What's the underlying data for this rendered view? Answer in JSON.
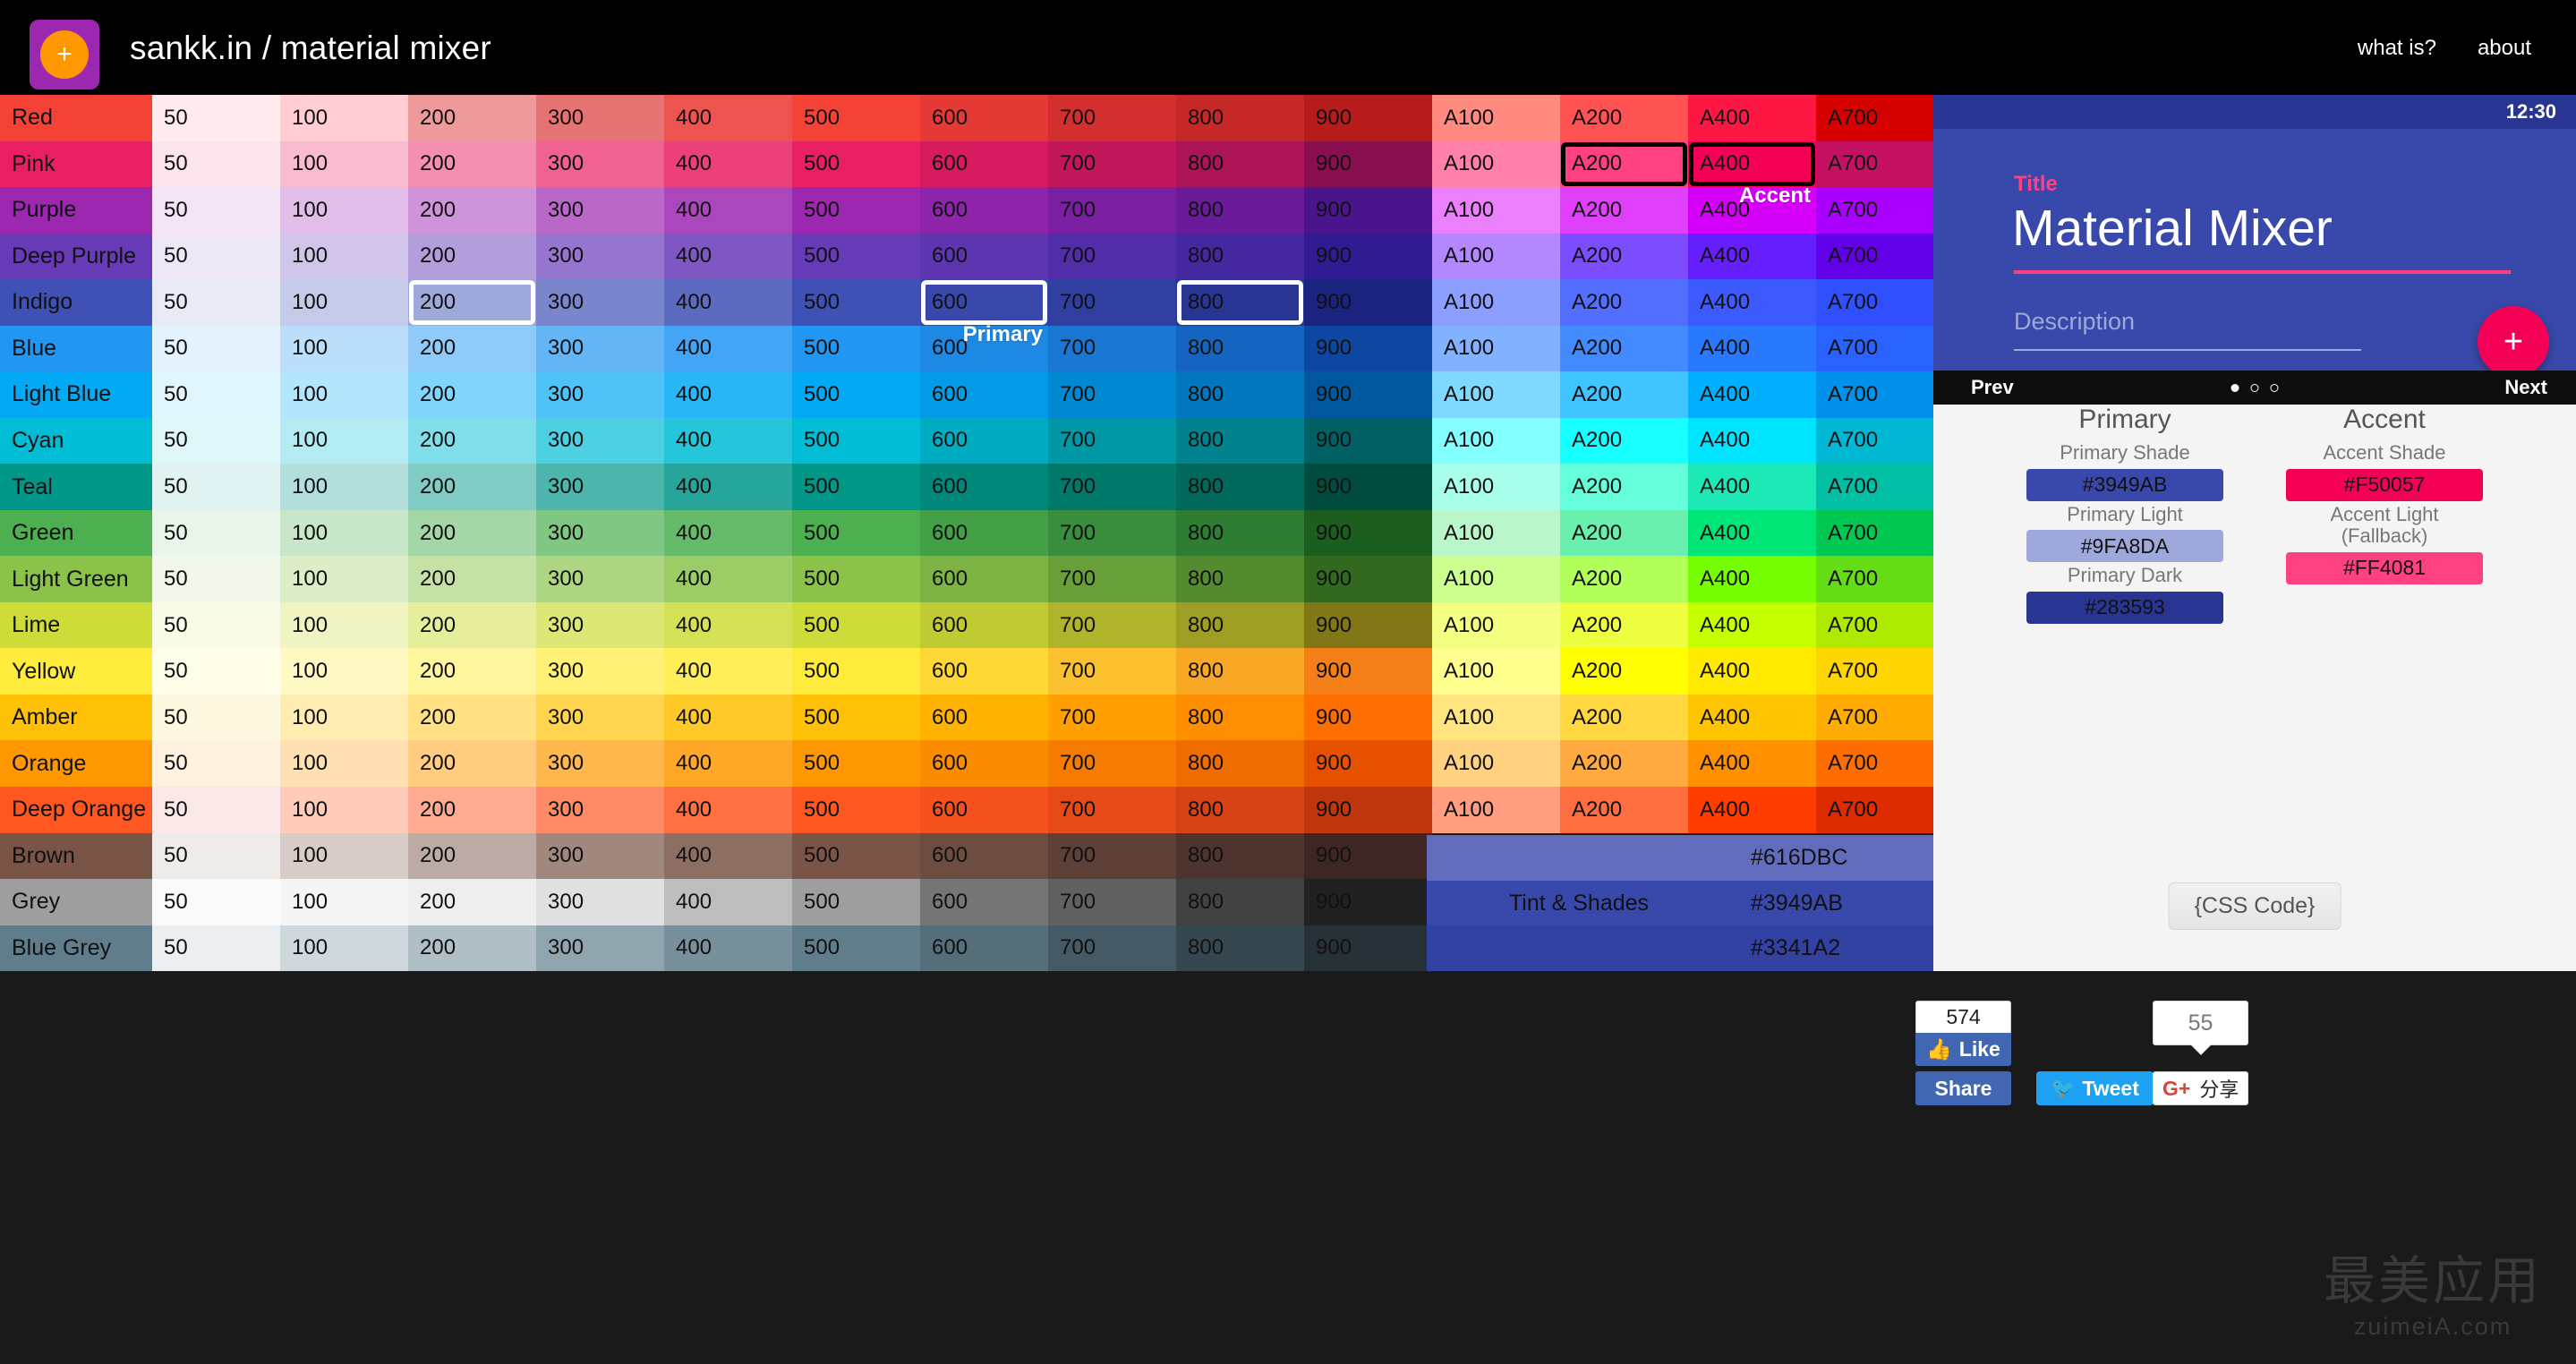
{
  "header": {
    "brand": "sankk.in / material mixer",
    "logo_plus": "+",
    "logo_bg": "#9C27B0",
    "logo_circle_bg": "#FF9800",
    "nav": [
      {
        "label": "what is?"
      },
      {
        "label": "about"
      }
    ]
  },
  "palette": {
    "shade_columns": [
      "50",
      "100",
      "200",
      "300",
      "400",
      "500",
      "600",
      "700",
      "800",
      "900"
    ],
    "accent_columns": [
      "A100",
      "A200",
      "A400",
      "A700"
    ],
    "rows": [
      {
        "name": "Red",
        "label_bg": "#F44336",
        "shades": [
          "#FFEBEE",
          "#FFCDD2",
          "#EF9A9A",
          "#E57373",
          "#EF5350",
          "#F44336",
          "#E53935",
          "#D32F2F",
          "#C62828",
          "#B71C1C"
        ],
        "accents": [
          "#FF8A80",
          "#FF5252",
          "#FF1744",
          "#D50000"
        ]
      },
      {
        "name": "Pink",
        "label_bg": "#E91E63",
        "shades": [
          "#FCE4EC",
          "#F8BBD0",
          "#F48FB1",
          "#F06292",
          "#EC407A",
          "#E91E63",
          "#D81B60",
          "#C2185B",
          "#AD1457",
          "#880E4F"
        ],
        "accents": [
          "#FF80AB",
          "#FF4081",
          "#F50057",
          "#C51162"
        ]
      },
      {
        "name": "Purple",
        "label_bg": "#9C27B0",
        "shades": [
          "#F3E5F5",
          "#E1BEE7",
          "#CE93D8",
          "#BA68C8",
          "#AB47BC",
          "#9C27B0",
          "#8E24AA",
          "#7B1FA2",
          "#6A1B9A",
          "#4A148C"
        ],
        "accents": [
          "#EA80FC",
          "#E040FB",
          "#D500F9",
          "#AA00FF"
        ]
      },
      {
        "name": "Deep Purple",
        "label_bg": "#673AB7",
        "shades": [
          "#EDE7F6",
          "#D1C4E9",
          "#B39DDB",
          "#9575CD",
          "#7E57C2",
          "#673AB7",
          "#5E35B1",
          "#512DA8",
          "#4527A0",
          "#311B92"
        ],
        "accents": [
          "#B388FF",
          "#7C4DFF",
          "#651FFF",
          "#6200EA"
        ]
      },
      {
        "name": "Indigo",
        "label_bg": "#3F51B5",
        "shades": [
          "#E8EAF6",
          "#C5CAE9",
          "#9FA8DA",
          "#7986CB",
          "#5C6BC0",
          "#3F51B5",
          "#3949AB",
          "#303F9F",
          "#283593",
          "#1A237E"
        ],
        "accents": [
          "#8C9EFF",
          "#536DFE",
          "#3D5AFE",
          "#304FFE"
        ]
      },
      {
        "name": "Blue",
        "label_bg": "#2196F3",
        "shades": [
          "#E3F2FD",
          "#BBDEFB",
          "#90CAF9",
          "#64B5F6",
          "#42A5F5",
          "#2196F3",
          "#1E88E5",
          "#1976D2",
          "#1565C0",
          "#0D47A1"
        ],
        "accents": [
          "#82B1FF",
          "#448AFF",
          "#2979FF",
          "#2962FF"
        ]
      },
      {
        "name": "Light Blue",
        "label_bg": "#03A9F4",
        "shades": [
          "#E1F5FE",
          "#B3E5FC",
          "#81D4FA",
          "#4FC3F7",
          "#29B6F6",
          "#03A9F4",
          "#039BE5",
          "#0288D1",
          "#0277BD",
          "#01579B"
        ],
        "accents": [
          "#80D8FF",
          "#40C4FF",
          "#00B0FF",
          "#0091EA"
        ]
      },
      {
        "name": "Cyan",
        "label_bg": "#00BCD4",
        "shades": [
          "#E0F7FA",
          "#B2EBF2",
          "#80DEEA",
          "#4DD0E1",
          "#26C6DA",
          "#00BCD4",
          "#00ACC1",
          "#0097A7",
          "#00838F",
          "#006064"
        ],
        "accents": [
          "#84FFFF",
          "#18FFFF",
          "#00E5FF",
          "#00B8D4"
        ]
      },
      {
        "name": "Teal",
        "label_bg": "#009688",
        "shades": [
          "#E0F2F1",
          "#B2DFDB",
          "#80CBC4",
          "#4DB6AC",
          "#26A69A",
          "#009688",
          "#00897B",
          "#00796B",
          "#00695C",
          "#004D40"
        ],
        "accents": [
          "#A7FFEB",
          "#64FFDA",
          "#1DE9B6",
          "#00BFA5"
        ]
      },
      {
        "name": "Green",
        "label_bg": "#4CAF50",
        "shades": [
          "#E8F5E9",
          "#C8E6C9",
          "#A5D6A7",
          "#81C784",
          "#66BB6A",
          "#4CAF50",
          "#43A047",
          "#388E3C",
          "#2E7D32",
          "#1B5E20"
        ],
        "accents": [
          "#B9F6CA",
          "#69F0AE",
          "#00E676",
          "#00C853"
        ]
      },
      {
        "name": "Light Green",
        "label_bg": "#8BC34A",
        "shades": [
          "#F1F8E9",
          "#DCEDC8",
          "#C5E1A5",
          "#AED581",
          "#9CCC65",
          "#8BC34A",
          "#7CB342",
          "#689F38",
          "#558B2F",
          "#33691E"
        ],
        "accents": [
          "#CCFF90",
          "#B2FF59",
          "#76FF03",
          "#64DD17"
        ]
      },
      {
        "name": "Lime",
        "label_bg": "#CDDC39",
        "shades": [
          "#F9FBE7",
          "#F0F4C3",
          "#E6EE9C",
          "#DCE775",
          "#D4E157",
          "#CDDC39",
          "#C0CA33",
          "#AFB42B",
          "#9E9D24",
          "#827717"
        ],
        "accents": [
          "#F4FF81",
          "#EEFF41",
          "#C6FF00",
          "#AEEA00"
        ]
      },
      {
        "name": "Yellow",
        "label_bg": "#FFEB3B",
        "shades": [
          "#FFFDE7",
          "#FFF9C4",
          "#FFF59D",
          "#FFF176",
          "#FFEE58",
          "#FFEB3B",
          "#FDD835",
          "#FBC02D",
          "#F9A825",
          "#F57F17"
        ],
        "accents": [
          "#FFFF8D",
          "#FFFF00",
          "#FFEA00",
          "#FFD600"
        ]
      },
      {
        "name": "Amber",
        "label_bg": "#FFC107",
        "shades": [
          "#FFF8E1",
          "#FFECB3",
          "#FFE082",
          "#FFD54F",
          "#FFCA28",
          "#FFC107",
          "#FFB300",
          "#FFA000",
          "#FF8F00",
          "#FF6F00"
        ],
        "accents": [
          "#FFE57F",
          "#FFD740",
          "#FFC400",
          "#FFAB00"
        ]
      },
      {
        "name": "Orange",
        "label_bg": "#FF9800",
        "shades": [
          "#FFF3E0",
          "#FFE0B2",
          "#FFCC80",
          "#FFB74D",
          "#FFA726",
          "#FF9800",
          "#FB8C00",
          "#F57C00",
          "#EF6C00",
          "#E65100"
        ],
        "accents": [
          "#FFD180",
          "#FFAB40",
          "#FF9100",
          "#FF6D00"
        ]
      },
      {
        "name": "Deep Orange",
        "label_bg": "#FF5722",
        "shades": [
          "#FBE9E7",
          "#FFCCBC",
          "#FFAB91",
          "#FF8A65",
          "#FF7043",
          "#FF5722",
          "#F4511E",
          "#E64A19",
          "#D84315",
          "#BF360C"
        ],
        "accents": [
          "#FF9E80",
          "#FF6E40",
          "#FF3D00",
          "#DD2C00"
        ]
      },
      {
        "name": "Brown",
        "label_bg": "#795548",
        "shades": [
          "#EFEBE9",
          "#D7CCC8",
          "#BCAAA4",
          "#A1887F",
          "#8D6E63",
          "#795548",
          "#6D4C41",
          "#5D4037",
          "#4E342E",
          "#3E2723"
        ],
        "accents": []
      },
      {
        "name": "Grey",
        "label_bg": "#9E9E9E",
        "shades": [
          "#FAFAFA",
          "#F5F5F5",
          "#EEEEEE",
          "#E0E0E0",
          "#BDBDBD",
          "#9E9E9E",
          "#757575",
          "#616161",
          "#424242",
          "#212121"
        ],
        "accents": []
      },
      {
        "name": "Blue Grey",
        "label_bg": "#607D8B",
        "shades": [
          "#ECEFF1",
          "#CFD8DC",
          "#B0BEC5",
          "#90A4AE",
          "#78909C",
          "#607D8B",
          "#546E7A",
          "#455A64",
          "#37474F",
          "#263238"
        ],
        "accents": []
      }
    ],
    "selections": [
      {
        "row": "Indigo",
        "column": "200",
        "style": "white",
        "tag": ""
      },
      {
        "row": "Indigo",
        "column": "600",
        "style": "white",
        "tag": "Primary"
      },
      {
        "row": "Indigo",
        "column": "800",
        "style": "white",
        "tag": ""
      },
      {
        "row": "Pink",
        "column": "A200",
        "style": "black",
        "tag": ""
      },
      {
        "row": "Pink",
        "column": "A400",
        "style": "black",
        "tag": "Accent"
      }
    ]
  },
  "tints": {
    "label": "Tint & Shades",
    "rows": [
      {
        "hex": "#616DBC"
      },
      {
        "hex": "#3949AB"
      },
      {
        "hex": "#3341A2"
      }
    ]
  },
  "preview": {
    "status_time": "12:30",
    "status_bg": "#283593",
    "body_bg": "#3949AB",
    "title_label": "Title",
    "title": "Material Mixer",
    "title_accent": "#FF4081",
    "description_placeholder": "Description",
    "fab_label": "+",
    "fab_bg": "#F50057",
    "nav": {
      "prev": "Prev",
      "next": "Next",
      "dots": 3,
      "active_dot": 1
    }
  },
  "details": {
    "primary": {
      "heading": "Primary",
      "items": [
        {
          "label": "Primary Shade",
          "hex": "#3949AB"
        },
        {
          "label": "Primary Light",
          "hex": "#9FA8DA"
        },
        {
          "label": "Primary Dark",
          "hex": "#283593"
        }
      ]
    },
    "accent": {
      "heading": "Accent",
      "items": [
        {
          "label": "Accent Shade",
          "hex": "#F50057"
        },
        {
          "label": "Accent Light\n(Fallback)",
          "hex": "#FF4081"
        }
      ]
    },
    "css_code_button": "{CSS Code}"
  },
  "social": {
    "facebook": {
      "count": "574",
      "like": "Like",
      "share": "Share",
      "icon": "thumbs-up-icon"
    },
    "twitter": {
      "label": "Tweet",
      "icon": "twitter-bird-icon"
    },
    "googleplus": {
      "count": "55",
      "label": "分享",
      "glyph": "G+"
    }
  },
  "watermark": {
    "cn": "最美应用",
    "en": "zuimeiA.com"
  }
}
